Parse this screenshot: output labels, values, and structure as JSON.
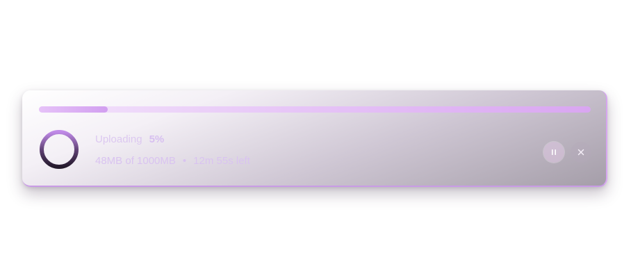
{
  "upload": {
    "status_label": "Uploading",
    "percent_label": "5%",
    "progress_fraction": 0.05,
    "transferred": "48MB of 1000MB",
    "separator": "•",
    "time_left": "12m 55s left"
  },
  "controls": {
    "pause_icon": "pause-icon",
    "close_icon": "close-icon"
  },
  "colors": {
    "accent": "#d29ff0",
    "ring_dark": "#2b1f33",
    "ring_light": "#b07fe0"
  }
}
